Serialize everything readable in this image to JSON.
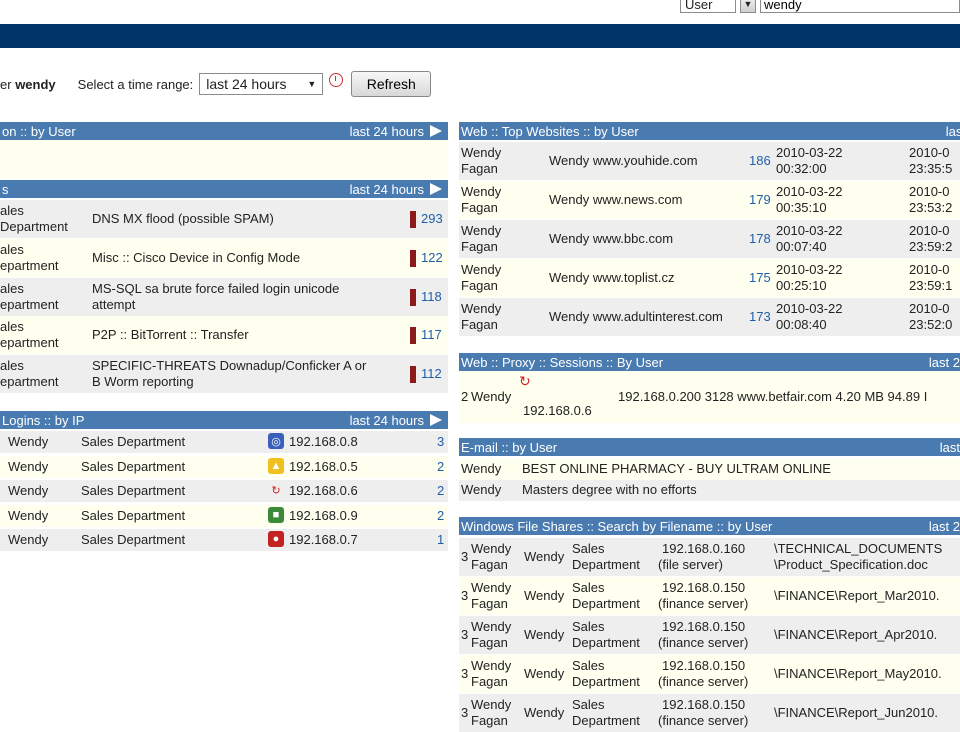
{
  "top": {
    "type_value": "User",
    "search_value": "wendy"
  },
  "timebar": {
    "user_prefix": "er",
    "user_name": "wendy",
    "range_label": "Select a time range:",
    "range_value": "last 24 hours",
    "refresh_label": "Refresh"
  },
  "panels": {
    "info": {
      "title": "on :: by User",
      "range": "last 24 hours"
    },
    "alerts": {
      "title": "s",
      "range": "last 24 hours",
      "rows": [
        {
          "dept1": "ales",
          "dept2": "Department",
          "desc1": "DNS MX flood (possible SPAM)",
          "desc2": "",
          "count": "293"
        },
        {
          "dept1": "ales",
          "dept2": "epartment",
          "desc1": "Misc :: Cisco Device in Config Mode",
          "desc2": "",
          "count": "122"
        },
        {
          "dept1": "ales",
          "dept2": "epartment",
          "desc1": "MS-SQL sa brute force failed login unicode",
          "desc2": "attempt",
          "count": "118"
        },
        {
          "dept1": "ales",
          "dept2": "epartment",
          "desc1": "P2P :: BitTorrent :: Transfer",
          "desc2": "",
          "count": "117"
        },
        {
          "dept1": "ales",
          "dept2": "epartment",
          "desc1": "SPECIFIC-THREATS Downadup/Conficker A or",
          "desc2": "B Worm reporting",
          "count": "112"
        }
      ]
    },
    "logins": {
      "title": "Logins :: by IP",
      "range": "last 24 hours",
      "rows": [
        {
          "user": "Wendy",
          "dept": "Sales Department",
          "ip": "192.168.0.8",
          "count": "3",
          "icon": "os-icon-blue"
        },
        {
          "user": "Wendy",
          "dept": "Sales Department",
          "ip": "192.168.0.5",
          "count": "2",
          "icon": "linux-penguin-icon"
        },
        {
          "user": "Wendy",
          "dept": "Sales Department",
          "ip": "192.168.0.6",
          "count": "2",
          "icon": "network-swirl-icon"
        },
        {
          "user": "Wendy",
          "dept": "Sales Department",
          "ip": "192.168.0.9",
          "count": "2",
          "icon": "windows-icon"
        },
        {
          "user": "Wendy",
          "dept": "Sales Department",
          "ip": "192.168.0.7",
          "count": "1",
          "icon": "redhat-icon"
        }
      ]
    },
    "web": {
      "title": "Web :: Top Websites :: by User",
      "range": "last",
      "rows": [
        {
          "name1": "Wendy",
          "name2": "Fagan",
          "site": "Wendy www.youhide.com",
          "count": "186",
          "start1": "2010-03-22",
          "start2": "00:32:00",
          "end1": "2010-0",
          "end2": "23:35:5"
        },
        {
          "name1": "Wendy",
          "name2": "Fagan",
          "site": "Wendy www.news.com",
          "count": "179",
          "start1": "2010-03-22",
          "start2": "00:35:10",
          "end1": "2010-0",
          "end2": "23:53:2"
        },
        {
          "name1": "Wendy",
          "name2": "Fagan",
          "site": "Wendy www.bbc.com",
          "count": "178",
          "start1": "2010-03-22",
          "start2": "00:07:40",
          "end1": "2010-0",
          "end2": "23:59:2"
        },
        {
          "name1": "Wendy",
          "name2": "Fagan",
          "site": "Wendy www.toplist.cz",
          "count": "175",
          "start1": "2010-03-22",
          "start2": "00:25:10",
          "end1": "2010-0",
          "end2": "23:59:1"
        },
        {
          "name1": "Wendy",
          "name2": "Fagan",
          "site": "Wendy www.adultinterest.com",
          "count": "173",
          "start1": "2010-03-22",
          "start2": "00:08:40",
          "end1": "2010-0",
          "end2": "23:52:0"
        }
      ]
    },
    "proxy": {
      "title": "Web :: Proxy :: Sessions :: By User",
      "range": "last 2",
      "row": {
        "idx": "2",
        "user": "Wendy",
        "ip": "192.168.0.6",
        "rest": "192.168.0.200 3128 www.betfair.com 4.20 MB 94.89 I"
      }
    },
    "email": {
      "title": "E-mail :: by User",
      "range": "last",
      "rows": [
        {
          "user": "Wendy",
          "subject": "BEST ONLINE PHARMACY - BUY ULTRAM ONLINE"
        },
        {
          "user": "Wendy",
          "subject": "Masters degree with no efforts"
        }
      ]
    },
    "shares": {
      "title": "Windows File Shares :: Search by Filename :: by User",
      "range": "last 2",
      "rows": [
        {
          "idx": "3",
          "n1": "Wendy",
          "n2": "Fagan",
          "user": "Wendy",
          "d1": "Sales",
          "d2": "Department",
          "ip": "192.168.0.160",
          "host": "(file server)",
          "p1": "\\TECHNICAL_DOCUMENTS",
          "p2": "\\Product_Specification.doc"
        },
        {
          "idx": "3",
          "n1": "Wendy",
          "n2": "Fagan",
          "user": "Wendy",
          "d1": "Sales",
          "d2": "Department",
          "ip": "192.168.0.150",
          "host": "(finance server)",
          "p1": "\\FINANCE\\Report_Mar2010.",
          "p2": ""
        },
        {
          "idx": "3",
          "n1": "Wendy",
          "n2": "Fagan",
          "user": "Wendy",
          "d1": "Sales",
          "d2": "Department",
          "ip": "192.168.0.150",
          "host": "(finance server)",
          "p1": "\\FINANCE\\Report_Apr2010.",
          "p2": ""
        },
        {
          "idx": "3",
          "n1": "Wendy",
          "n2": "Fagan",
          "user": "Wendy",
          "d1": "Sales",
          "d2": "Department",
          "ip": "192.168.0.150",
          "host": "(finance server)",
          "p1": "\\FINANCE\\Report_May2010.",
          "p2": ""
        },
        {
          "idx": "3",
          "n1": "Wendy",
          "n2": "Fagan",
          "user": "Wendy",
          "d1": "Sales",
          "d2": "Department",
          "ip": "192.168.0.150",
          "host": "(finance server)",
          "p1": "\\FINANCE\\Report_Jun2010.",
          "p2": ""
        }
      ]
    }
  }
}
